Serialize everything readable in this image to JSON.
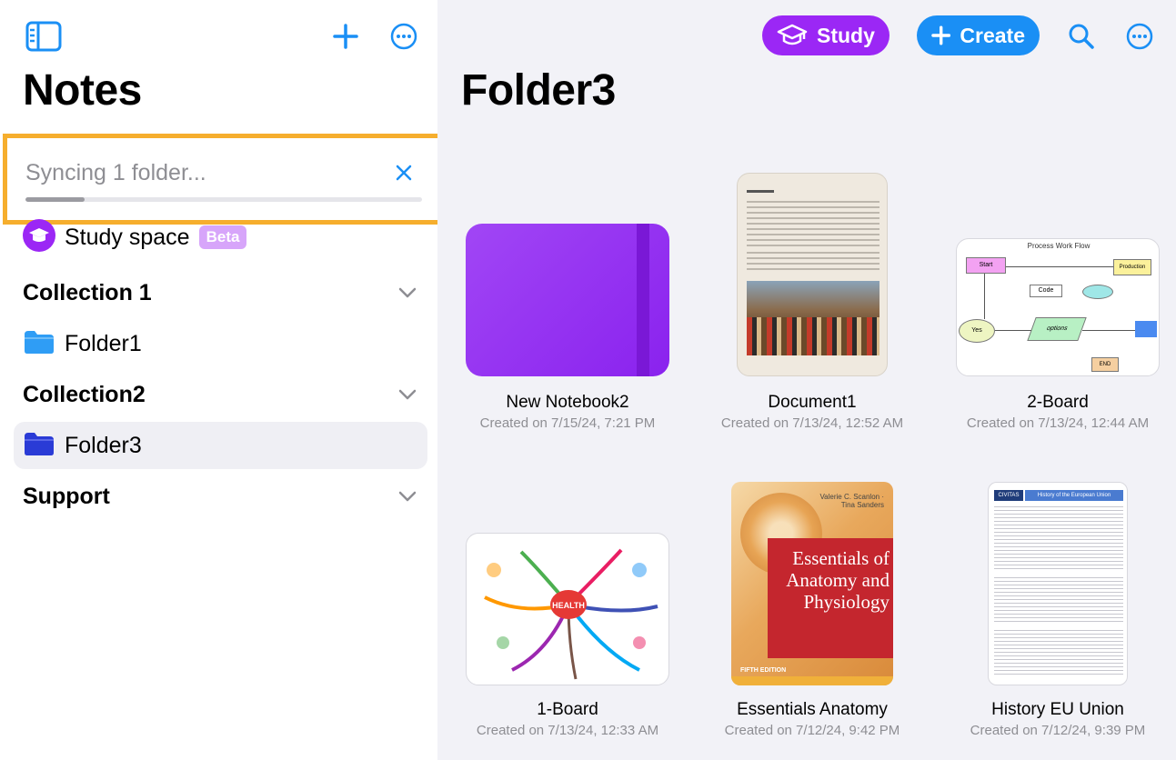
{
  "sidebar": {
    "title": "Notes",
    "sync": {
      "text": "Syncing 1 folder...",
      "progress": 0.15
    },
    "study_space": {
      "label": "Study space",
      "badge": "Beta"
    },
    "items": [
      {
        "label": "Collection 1",
        "type": "section"
      },
      {
        "label": "Folder1",
        "type": "folder"
      },
      {
        "label": "Collection2",
        "type": "section"
      },
      {
        "label": "Folder3",
        "type": "folder",
        "selected": true
      },
      {
        "label": "Support",
        "type": "section"
      }
    ]
  },
  "main": {
    "title": "Folder3",
    "study_label": "Study",
    "create_label": "Create",
    "notes": [
      {
        "title": "New Notebook2",
        "date": "Created on 7/15/24, 7:21 PM"
      },
      {
        "title": "Document1",
        "date": "Created on 7/13/24, 12:52 AM"
      },
      {
        "title": "2-Board",
        "date": "Created on 7/13/24, 12:44 AM"
      },
      {
        "title": "1-Board",
        "date": "Created on 7/13/24, 12:33 AM"
      },
      {
        "title": "Essentials Anatomy",
        "date": "Created on 7/12/24, 9:42 PM"
      },
      {
        "title": "History EU Union",
        "date": "Created on 7/12/24, 9:39 PM"
      }
    ],
    "thumb_text": {
      "board_heading": "Process Work Flow",
      "board_boxes": [
        "Start",
        "Code",
        "Yes",
        "options",
        "Production",
        "END"
      ],
      "health_center": "HEALTH",
      "book_title_1": "Essentials of",
      "book_title_2": "Anatomy and",
      "book_title_3": "Physiology",
      "book_authors": "Valerie C. Scanlon · Tina Sanders",
      "book_edition": "FIFTH EDITION",
      "eu_header": "History of the European Union",
      "eu_logo": "CIVITAS"
    }
  },
  "colors": {
    "accent_blue": "#1a8ff5",
    "study_purple": "#9b27f5",
    "sync_highlight": "#f6ae2d",
    "folder1_blue": "#2f9df5",
    "folder3_indigo": "#2a3bd6"
  }
}
